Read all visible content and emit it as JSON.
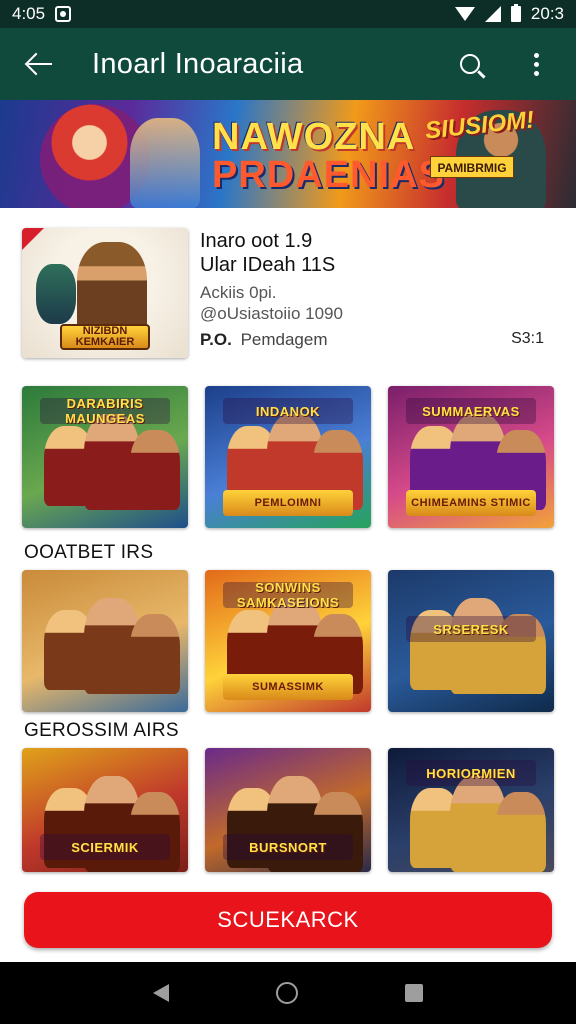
{
  "status_bar": {
    "time": "4:05",
    "battery_text": "20:3"
  },
  "app_bar": {
    "title": "Inoarl Inoaraciia"
  },
  "banner": {
    "title_line1": "NAWOZNA",
    "title_line2": "PRDAENIAS",
    "side_text": "SIUSIOM!",
    "side_plate": "PAMIBRMIG"
  },
  "featured": {
    "badge": "NIZIBDN KEMKAIER",
    "line1": "Inaro oot 1.9",
    "line2": "Ular IDeah 11S",
    "line3": "Ackiis 0pi.",
    "line4": "@oUsiastoiio 1090",
    "meta_label": "P.O.",
    "meta_value": "Pemdagem",
    "price": "S3:1"
  },
  "row1": [
    {
      "label": "DARABIRIS MAUNGEAS",
      "colors": [
        "#2c7a3b",
        "#6aa84f",
        "#1f4f8a"
      ],
      "accent": "#8a1c1c",
      "plate_pos": "top"
    },
    {
      "label": "INDANOK",
      "label2": "PEMLOIMNI",
      "colors": [
        "#1c3f8a",
        "#4a7fd6",
        "#26a35b"
      ],
      "accent": "#c0392b",
      "plate_pos": "top"
    },
    {
      "label": "SUMMAERVAS",
      "label2": "CHIMEAMINS STIMIC",
      "colors": [
        "#7a1f6a",
        "#d64a8a",
        "#f1a23a"
      ],
      "accent": "#6a1c8a",
      "plate_pos": "top"
    }
  ],
  "section1_title": "OOATBET IRS",
  "row2": [
    {
      "label": "",
      "colors": [
        "#c98b3a",
        "#e8b86a",
        "#3a6a9a"
      ],
      "accent": "#7a3a1a",
      "plate_pos": "none"
    },
    {
      "label": "SONWINS SAMKASEIONS",
      "label2": "SUMASSIMK",
      "colors": [
        "#e26a1a",
        "#ffd23a",
        "#c0392b"
      ],
      "accent": "#7a1c0a",
      "plate_pos": "top"
    },
    {
      "label": "SRSERESK",
      "colors": [
        "#1c3a6a",
        "#2a5a9a",
        "#0f2a4a"
      ],
      "accent": "#d6a23a",
      "plate_pos": "center"
    }
  ],
  "section2_title": "GEROSSIM AIRS",
  "row3": [
    {
      "label": "SCIERMIK",
      "colors": [
        "#e0a21a",
        "#c0392b",
        "#7a1f1a"
      ],
      "accent": "#5a1a0a",
      "plate_pos": "bottom"
    },
    {
      "label": "BURSNORT",
      "colors": [
        "#6a2a8a",
        "#c26a2a",
        "#2a2a4a"
      ],
      "accent": "#3a1a0a",
      "plate_pos": "bottom"
    },
    {
      "label": "HORIORMIEN",
      "colors": [
        "#0f1a3a",
        "#2a3f6a",
        "#4a4a5a"
      ],
      "accent": "#d6a23a",
      "plate_pos": "top"
    }
  ],
  "cta": {
    "label": "SCUEKARCK"
  },
  "theme": {
    "appbar": "#0f4a3d",
    "statusbar": "#0d2e26",
    "cta": "#e8131b"
  }
}
